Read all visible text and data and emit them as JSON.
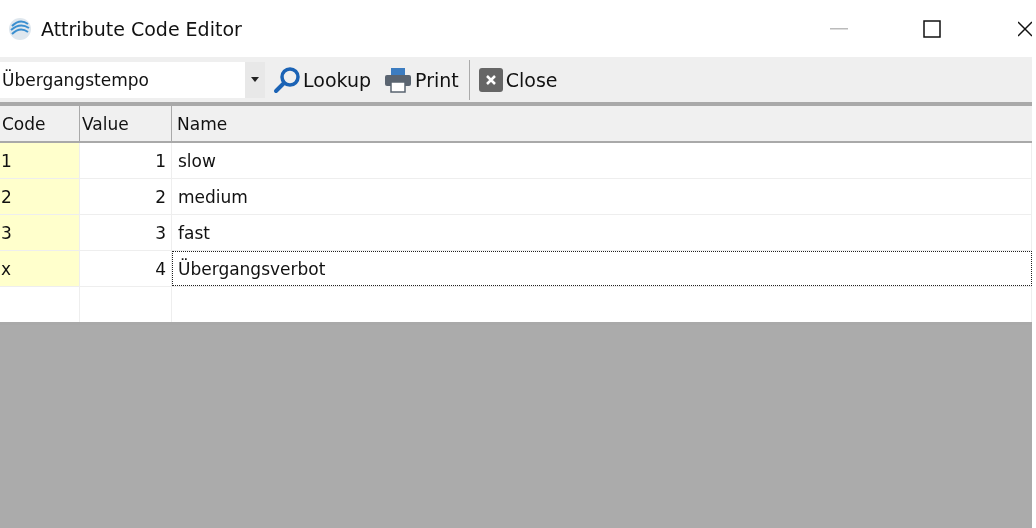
{
  "window": {
    "title": "Attribute Code Editor"
  },
  "toolbar": {
    "attribute_select": {
      "value": "Übergangstempo"
    },
    "buttons": [
      {
        "kind": "lookup",
        "label": "Lookup"
      },
      {
        "kind": "print",
        "label": "Print"
      },
      {
        "kind": "close",
        "label": "Close"
      }
    ]
  },
  "table": {
    "columns": [
      "Code",
      "Value",
      "Name"
    ],
    "rows": [
      {
        "code": "1",
        "value": "1",
        "name": "slow",
        "focused": false
      },
      {
        "code": "2",
        "value": "2",
        "name": "medium",
        "focused": false
      },
      {
        "code": "3",
        "value": "3",
        "name": "fast",
        "focused": false
      },
      {
        "code": "x",
        "value": "4",
        "name": "Übergangsverbot",
        "focused": true
      }
    ]
  }
}
